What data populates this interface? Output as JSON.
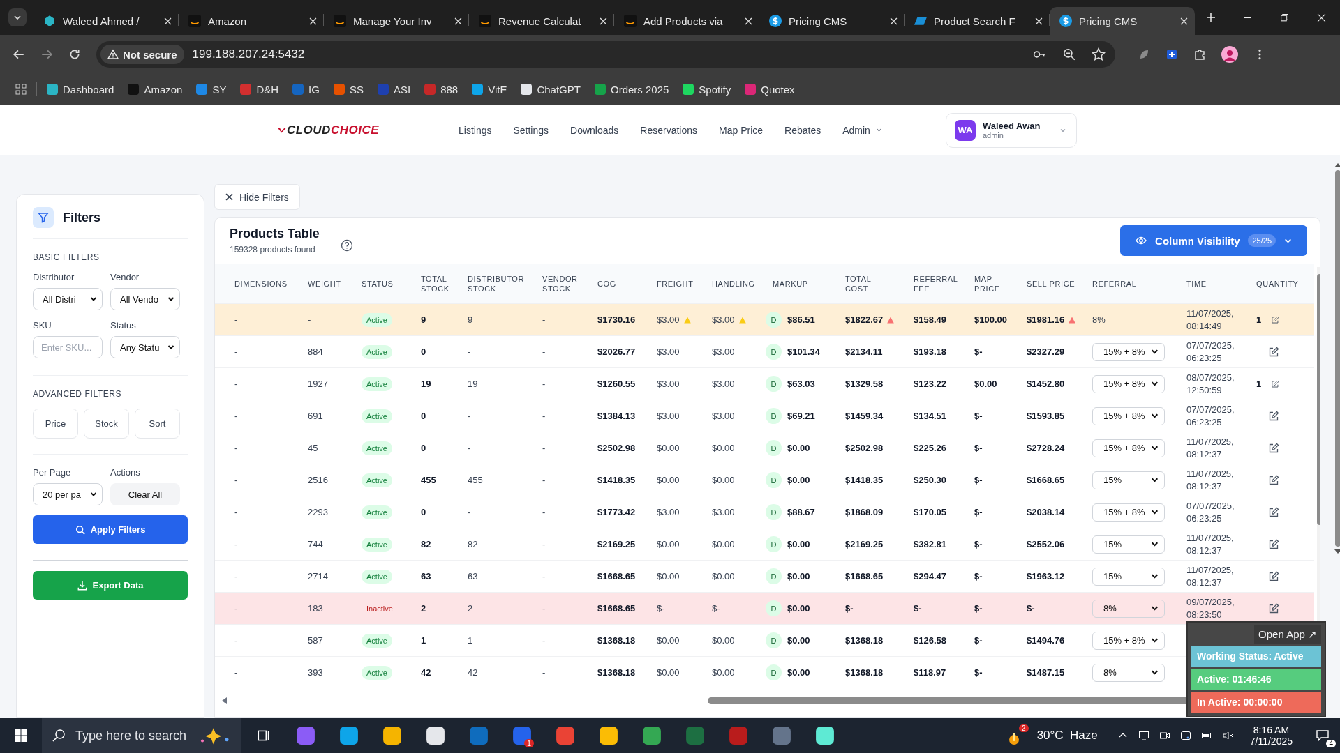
{
  "browser": {
    "tabs": [
      {
        "title": "Waleed Ahmed /",
        "kind": "hex",
        "selected": false
      },
      {
        "title": "Amazon",
        "kind": "amazon",
        "selected": false
      },
      {
        "title": "Manage Your Inv",
        "kind": "amazon",
        "selected": false
      },
      {
        "title": "Revenue Calculat",
        "kind": "amazon",
        "selected": false
      },
      {
        "title": "Add Products via",
        "kind": "amazon",
        "selected": false
      },
      {
        "title": "Pricing CMS",
        "kind": "dollar",
        "selected": false
      },
      {
        "title": "Product Search F",
        "kind": "ec",
        "selected": false
      },
      {
        "title": "Pricing CMS",
        "kind": "dollar",
        "selected": true
      }
    ],
    "security": "Not secure",
    "address": "199.188.207.24:5432",
    "bookmarks": [
      {
        "label": "Dashboard",
        "color": "#2bb5c5"
      },
      {
        "label": "Amazon",
        "color": "#111111"
      },
      {
        "label": "SY",
        "color": "#1e88e5"
      },
      {
        "label": "D&H",
        "color": "#d32f2f"
      },
      {
        "label": "IG",
        "color": "#1565c0"
      },
      {
        "label": "SS",
        "color": "#e65100"
      },
      {
        "label": "ASI",
        "color": "#1e40af"
      },
      {
        "label": "888",
        "color": "#c62828"
      },
      {
        "label": "VitE",
        "color": "#0ea5e9"
      },
      {
        "label": "ChatGPT",
        "color": "#e5e7eb"
      },
      {
        "label": "Orders 2025",
        "color": "#16a34a"
      },
      {
        "label": "Spotify",
        "color": "#1ed760"
      },
      {
        "label": "Quotex",
        "color": "#db2777"
      }
    ]
  },
  "nav": {
    "logo_main": "CLOUD",
    "logo_accent": "CHOICE",
    "items": [
      "Listings",
      "Settings",
      "Downloads",
      "Reservations",
      "Map Price",
      "Rebates",
      "Admin"
    ],
    "user": {
      "initials": "WA",
      "name": "Waleed Awan",
      "role": "admin"
    }
  },
  "filters": {
    "title": "Filters",
    "basic_heading": "BASIC FILTERS",
    "distributor": {
      "label": "Distributor",
      "value": "All Distri"
    },
    "vendor": {
      "label": "Vendor",
      "value": "All Vendo"
    },
    "sku": {
      "label": "SKU",
      "placeholder": "Enter SKU..."
    },
    "status": {
      "label": "Status",
      "value": "Any Statu"
    },
    "advanced_heading": "ADVANCED FILTERS",
    "advanced_buttons": [
      "Price",
      "Stock",
      "Sort"
    ],
    "per_page": {
      "label": "Per Page",
      "value": "20 per pa"
    },
    "actions_label": "Actions",
    "clear_button": "Clear All",
    "apply_button": "Apply Filters",
    "export_button": "Export Data"
  },
  "hide_filters": "Hide Filters",
  "table": {
    "title": "Products Table",
    "count": "159328 products found",
    "column_visibility": "Column Visibility",
    "visibility_count": "25/25",
    "columns": [
      "DIMENSIONS",
      "WEIGHT",
      "STATUS",
      "TOTAL STOCK",
      "DISTRIBUTOR STOCK",
      "VENDOR STOCK",
      "COG",
      "FREIGHT",
      "HANDLING",
      "MARKUP",
      "TOTAL COST",
      "REFERRAL FEE",
      "MAP PRICE",
      "SELL PRICE",
      "REFERRAL",
      "TIME",
      "QUANTITY"
    ],
    "rows": [
      {
        "flagged": true,
        "dimensions": "-",
        "weight": "-",
        "status": "Active",
        "active": true,
        "total_stock": "9",
        "distributor_stock": "9",
        "vendor_stock": "-",
        "cog": "$1730.16",
        "freight": "$3.00",
        "freight_warning": true,
        "handling": "$3.00",
        "handling_warning": true,
        "markup_type": "D",
        "markup": "$86.51",
        "total_cost": "$1822.67",
        "total_cost_warning": true,
        "referral_fee": "$158.49",
        "map_price": "$100.00",
        "sell_price": "$1981.16",
        "sell_price_warning": true,
        "referral": {
          "kind": "text",
          "value": "8%"
        },
        "time": "11/07/2025, 08:14:49",
        "quantity": "1"
      },
      {
        "flagged": false,
        "dimensions": "-",
        "weight": "884",
        "status": "Active",
        "active": true,
        "total_stock": "0",
        "distributor_stock": "-",
        "vendor_stock": "-",
        "cog": "$2026.77",
        "freight": "$3.00",
        "freight_warning": false,
        "handling": "$3.00",
        "handling_warning": false,
        "markup_type": "D",
        "markup": "$101.34",
        "total_cost": "$2134.11",
        "total_cost_warning": false,
        "referral_fee": "$193.18",
        "map_price": "$-",
        "sell_price": "$2327.29",
        "sell_price_warning": false,
        "referral": {
          "kind": "select",
          "value": "15% + 8%"
        },
        "time": "07/07/2025, 06:23:25"
      },
      {
        "flagged": false,
        "dimensions": "-",
        "weight": "1927",
        "status": "Active",
        "active": true,
        "total_stock": "19",
        "distributor_stock": "19",
        "vendor_stock": "-",
        "cog": "$1260.55",
        "freight": "$3.00",
        "freight_warning": false,
        "handling": "$3.00",
        "handling_warning": false,
        "markup_type": "D",
        "markup": "$63.03",
        "total_cost": "$1329.58",
        "total_cost_warning": false,
        "referral_fee": "$123.22",
        "map_price": "$0.00",
        "sell_price": "$1452.80",
        "sell_price_warning": false,
        "referral": {
          "kind": "select",
          "value": "15% + 8%"
        },
        "time": "08/07/2025, 12:50:59",
        "quantity": "1"
      },
      {
        "flagged": false,
        "dimensions": "-",
        "weight": "691",
        "status": "Active",
        "active": true,
        "total_stock": "0",
        "distributor_stock": "-",
        "vendor_stock": "-",
        "cog": "$1384.13",
        "freight": "$3.00",
        "freight_warning": false,
        "handling": "$3.00",
        "handling_warning": false,
        "markup_type": "D",
        "markup": "$69.21",
        "total_cost": "$1459.34",
        "total_cost_warning": false,
        "referral_fee": "$134.51",
        "map_price": "$-",
        "sell_price": "$1593.85",
        "sell_price_warning": false,
        "referral": {
          "kind": "select",
          "value": "15% + 8%"
        },
        "time": "07/07/2025, 06:23:25"
      },
      {
        "flagged": false,
        "dimensions": "-",
        "weight": "45",
        "status": "Active",
        "active": true,
        "total_stock": "0",
        "distributor_stock": "-",
        "vendor_stock": "-",
        "cog": "$2502.98",
        "freight": "$0.00",
        "freight_warning": false,
        "handling": "$0.00",
        "handling_warning": false,
        "markup_type": "D",
        "markup": "$0.00",
        "total_cost": "$2502.98",
        "total_cost_warning": false,
        "referral_fee": "$225.26",
        "map_price": "$-",
        "sell_price": "$2728.24",
        "sell_price_warning": false,
        "referral": {
          "kind": "select",
          "value": "15% + 8%"
        },
        "time": "11/07/2025, 08:12:37"
      },
      {
        "flagged": false,
        "dimensions": "-",
        "weight": "2516",
        "status": "Active",
        "active": true,
        "total_stock": "455",
        "distributor_stock": "455",
        "vendor_stock": "-",
        "cog": "$1418.35",
        "freight": "$0.00",
        "freight_warning": false,
        "handling": "$0.00",
        "handling_warning": false,
        "markup_type": "D",
        "markup": "$0.00",
        "total_cost": "$1418.35",
        "total_cost_warning": false,
        "referral_fee": "$250.30",
        "map_price": "$-",
        "sell_price": "$1668.65",
        "sell_price_warning": false,
        "referral": {
          "kind": "select",
          "value": "15%"
        },
        "time": "11/07/2025, 08:12:37"
      },
      {
        "flagged": false,
        "dimensions": "-",
        "weight": "2293",
        "status": "Active",
        "active": true,
        "total_stock": "0",
        "distributor_stock": "-",
        "vendor_stock": "-",
        "cog": "$1773.42",
        "freight": "$3.00",
        "freight_warning": false,
        "handling": "$3.00",
        "handling_warning": false,
        "markup_type": "D",
        "markup": "$88.67",
        "total_cost": "$1868.09",
        "total_cost_warning": false,
        "referral_fee": "$170.05",
        "map_price": "$-",
        "sell_price": "$2038.14",
        "sell_price_warning": false,
        "referral": {
          "kind": "select",
          "value": "15% + 8%"
        },
        "time": "07/07/2025, 06:23:25"
      },
      {
        "flagged": false,
        "dimensions": "-",
        "weight": "744",
        "status": "Active",
        "active": true,
        "total_stock": "82",
        "distributor_stock": "82",
        "vendor_stock": "-",
        "cog": "$2169.25",
        "freight": "$0.00",
        "freight_warning": false,
        "handling": "$0.00",
        "handling_warning": false,
        "markup_type": "D",
        "markup": "$0.00",
        "total_cost": "$2169.25",
        "total_cost_warning": false,
        "referral_fee": "$382.81",
        "map_price": "$-",
        "sell_price": "$2552.06",
        "sell_price_warning": false,
        "referral": {
          "kind": "select",
          "value": "15%"
        },
        "time": "11/07/2025, 08:12:37"
      },
      {
        "flagged": false,
        "dimensions": "-",
        "weight": "2714",
        "status": "Active",
        "active": true,
        "total_stock": "63",
        "distributor_stock": "63",
        "vendor_stock": "-",
        "cog": "$1668.65",
        "freight": "$0.00",
        "freight_warning": false,
        "handling": "$0.00",
        "handling_warning": false,
        "markup_type": "D",
        "markup": "$0.00",
        "total_cost": "$1668.65",
        "total_cost_warning": false,
        "referral_fee": "$294.47",
        "map_price": "$-",
        "sell_price": "$1963.12",
        "sell_price_warning": false,
        "referral": {
          "kind": "select",
          "value": "15%"
        },
        "time": "11/07/2025, 08:12:37"
      },
      {
        "flagged": false,
        "dimensions": "-",
        "weight": "183",
        "status": "Inactive",
        "active": false,
        "total_stock": "2",
        "distributor_stock": "2",
        "vendor_stock": "-",
        "cog": "$1668.65",
        "freight": "$-",
        "freight_warning": false,
        "handling": "$-",
        "handling_warning": false,
        "markup_type": "D",
        "markup": "$0.00",
        "total_cost": "$-",
        "total_cost_warning": false,
        "referral_fee": "$-",
        "map_price": "$-",
        "sell_price": "$-",
        "sell_price_warning": false,
        "referral": {
          "kind": "select",
          "value": "8%"
        },
        "time": "09/07/2025, 08:23:50"
      },
      {
        "flagged": false,
        "dimensions": "-",
        "weight": "587",
        "status": "Active",
        "active": true,
        "total_stock": "1",
        "distributor_stock": "1",
        "vendor_stock": "-",
        "cog": "$1368.18",
        "freight": "$0.00",
        "freight_warning": false,
        "handling": "$0.00",
        "handling_warning": false,
        "markup_type": "D",
        "markup": "$0.00",
        "total_cost": "$1368.18",
        "total_cost_warning": false,
        "referral_fee": "$126.58",
        "map_price": "$-",
        "sell_price": "$1494.76",
        "sell_price_warning": false,
        "referral": {
          "kind": "select",
          "value": "15% + 8%"
        }
      },
      {
        "flagged": false,
        "dimensions": "-",
        "weight": "393",
        "status": "Active",
        "active": true,
        "total_stock": "42",
        "distributor_stock": "42",
        "vendor_stock": "-",
        "cog": "$1368.18",
        "freight": "$0.00",
        "freight_warning": false,
        "handling": "$0.00",
        "handling_warning": false,
        "markup_type": "D",
        "markup": "$0.00",
        "total_cost": "$1368.18",
        "total_cost_warning": false,
        "referral_fee": "$118.97",
        "map_price": "$-",
        "sell_price": "$1487.15",
        "sell_price_warning": false,
        "referral": {
          "kind": "select",
          "value": "8%"
        }
      }
    ]
  },
  "tracker": {
    "open_app": "Open App ↗",
    "working_status": "Working Status: Active",
    "active_time": "Active: 01:46:46",
    "inactive_time": "In Active: 00:00:00"
  },
  "taskbar": {
    "search_placeholder": "Type here to search",
    "apps": [
      {
        "color": "#8b5cf6"
      },
      {
        "color": "#0ea5e9"
      },
      {
        "color": "#f5b400"
      },
      {
        "color": "#e5e7eb"
      },
      {
        "color": "#0f6cbd"
      },
      {
        "color": "#2563eb",
        "badge": "1"
      },
      {
        "color": "#ea4335"
      },
      {
        "color": "#fbbc05"
      },
      {
        "color": "#34a853"
      },
      {
        "color": "#1d6f42"
      },
      {
        "color": "#b91c1c"
      },
      {
        "color": "#64748b"
      },
      {
        "color": "#5eead4"
      }
    ],
    "weather_badge": "2",
    "weather": "30°C  Haze",
    "time": "8:16 AM",
    "date": "7/11/2025",
    "notifications": "4"
  }
}
